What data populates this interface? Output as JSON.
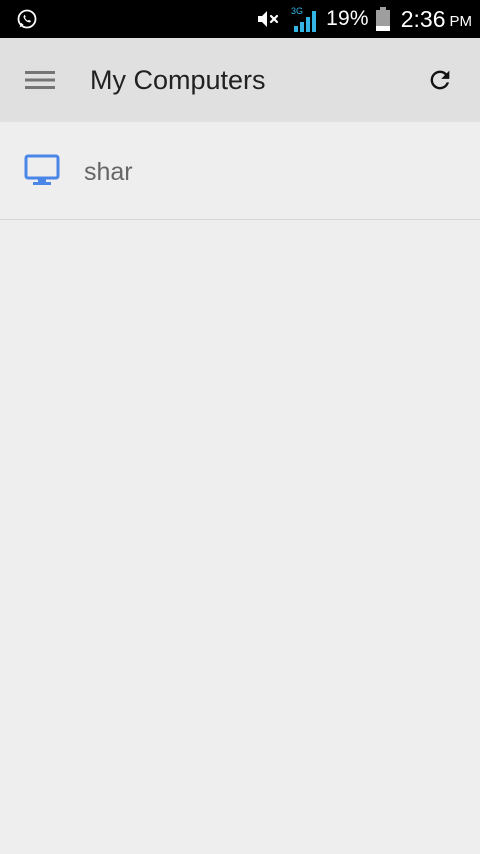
{
  "status_bar": {
    "left_icons": [
      "whatsapp-icon"
    ],
    "right_icons": [
      "mute-icon",
      "signal-3g-icon",
      "battery-icon"
    ],
    "network_label": "3G",
    "battery_percent": "19%",
    "time": "2:36",
    "ampm": "PM"
  },
  "toolbar": {
    "menu_icon": "hamburger-menu-icon",
    "title": "My Computers",
    "refresh_icon": "refresh-icon"
  },
  "computers": [
    {
      "name": "shar",
      "icon": "monitor-icon"
    }
  ],
  "colors": {
    "status_bar_bg": "#000000",
    "toolbar_bg": "#e0e0e0",
    "page_bg": "#eeeeee",
    "accent": "#4a86e8",
    "signal": "#33b5e5"
  }
}
